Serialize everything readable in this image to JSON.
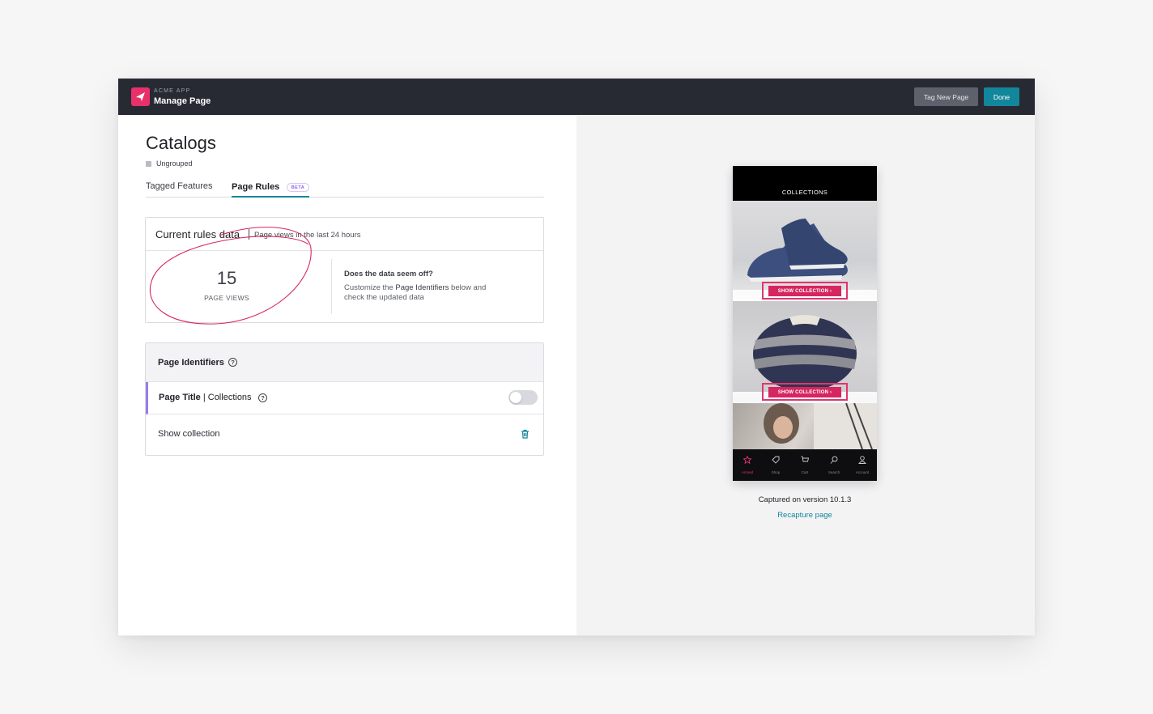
{
  "header": {
    "app_name": "ACME APP",
    "title": "Manage Page",
    "tag_new_page_label": "Tag New Page",
    "done_label": "Done"
  },
  "page": {
    "title": "Catalogs",
    "group": "Ungrouped",
    "tabs": [
      {
        "label": "Tagged Features",
        "active": false
      },
      {
        "label": "Page Rules",
        "active": true,
        "badge": "BETA"
      }
    ]
  },
  "rules_card": {
    "title": "Current rules data",
    "subtitle": "Page views in the last 24 hours",
    "metric_value": "15",
    "metric_label": "PAGE VIEWS",
    "question_title": "Does the data seem off?",
    "question_text_1": "Customize the ",
    "question_text_bold": "Page Identifiers",
    "question_text_2": " below and check the updated data"
  },
  "identifiers_card": {
    "title": "Page Identifiers",
    "rows": [
      {
        "label_bold": "Page Title",
        "label_value": "Collections",
        "toggle_on": false
      },
      {
        "label": "Show collection"
      }
    ]
  },
  "preview": {
    "screen_title": "COLLECTIONS",
    "show_collection_label": "SHOW COLLECTION",
    "nav": [
      "Arrived",
      "Shop",
      "Cart",
      "Search",
      "Account"
    ],
    "captured_text": "Captured on version 10.1.3",
    "recapture_label": "Recapture page"
  },
  "colors": {
    "topbar": "#272a33",
    "accent": "#12869b",
    "brand": "#e8316a",
    "highlight": "#e0356f"
  }
}
